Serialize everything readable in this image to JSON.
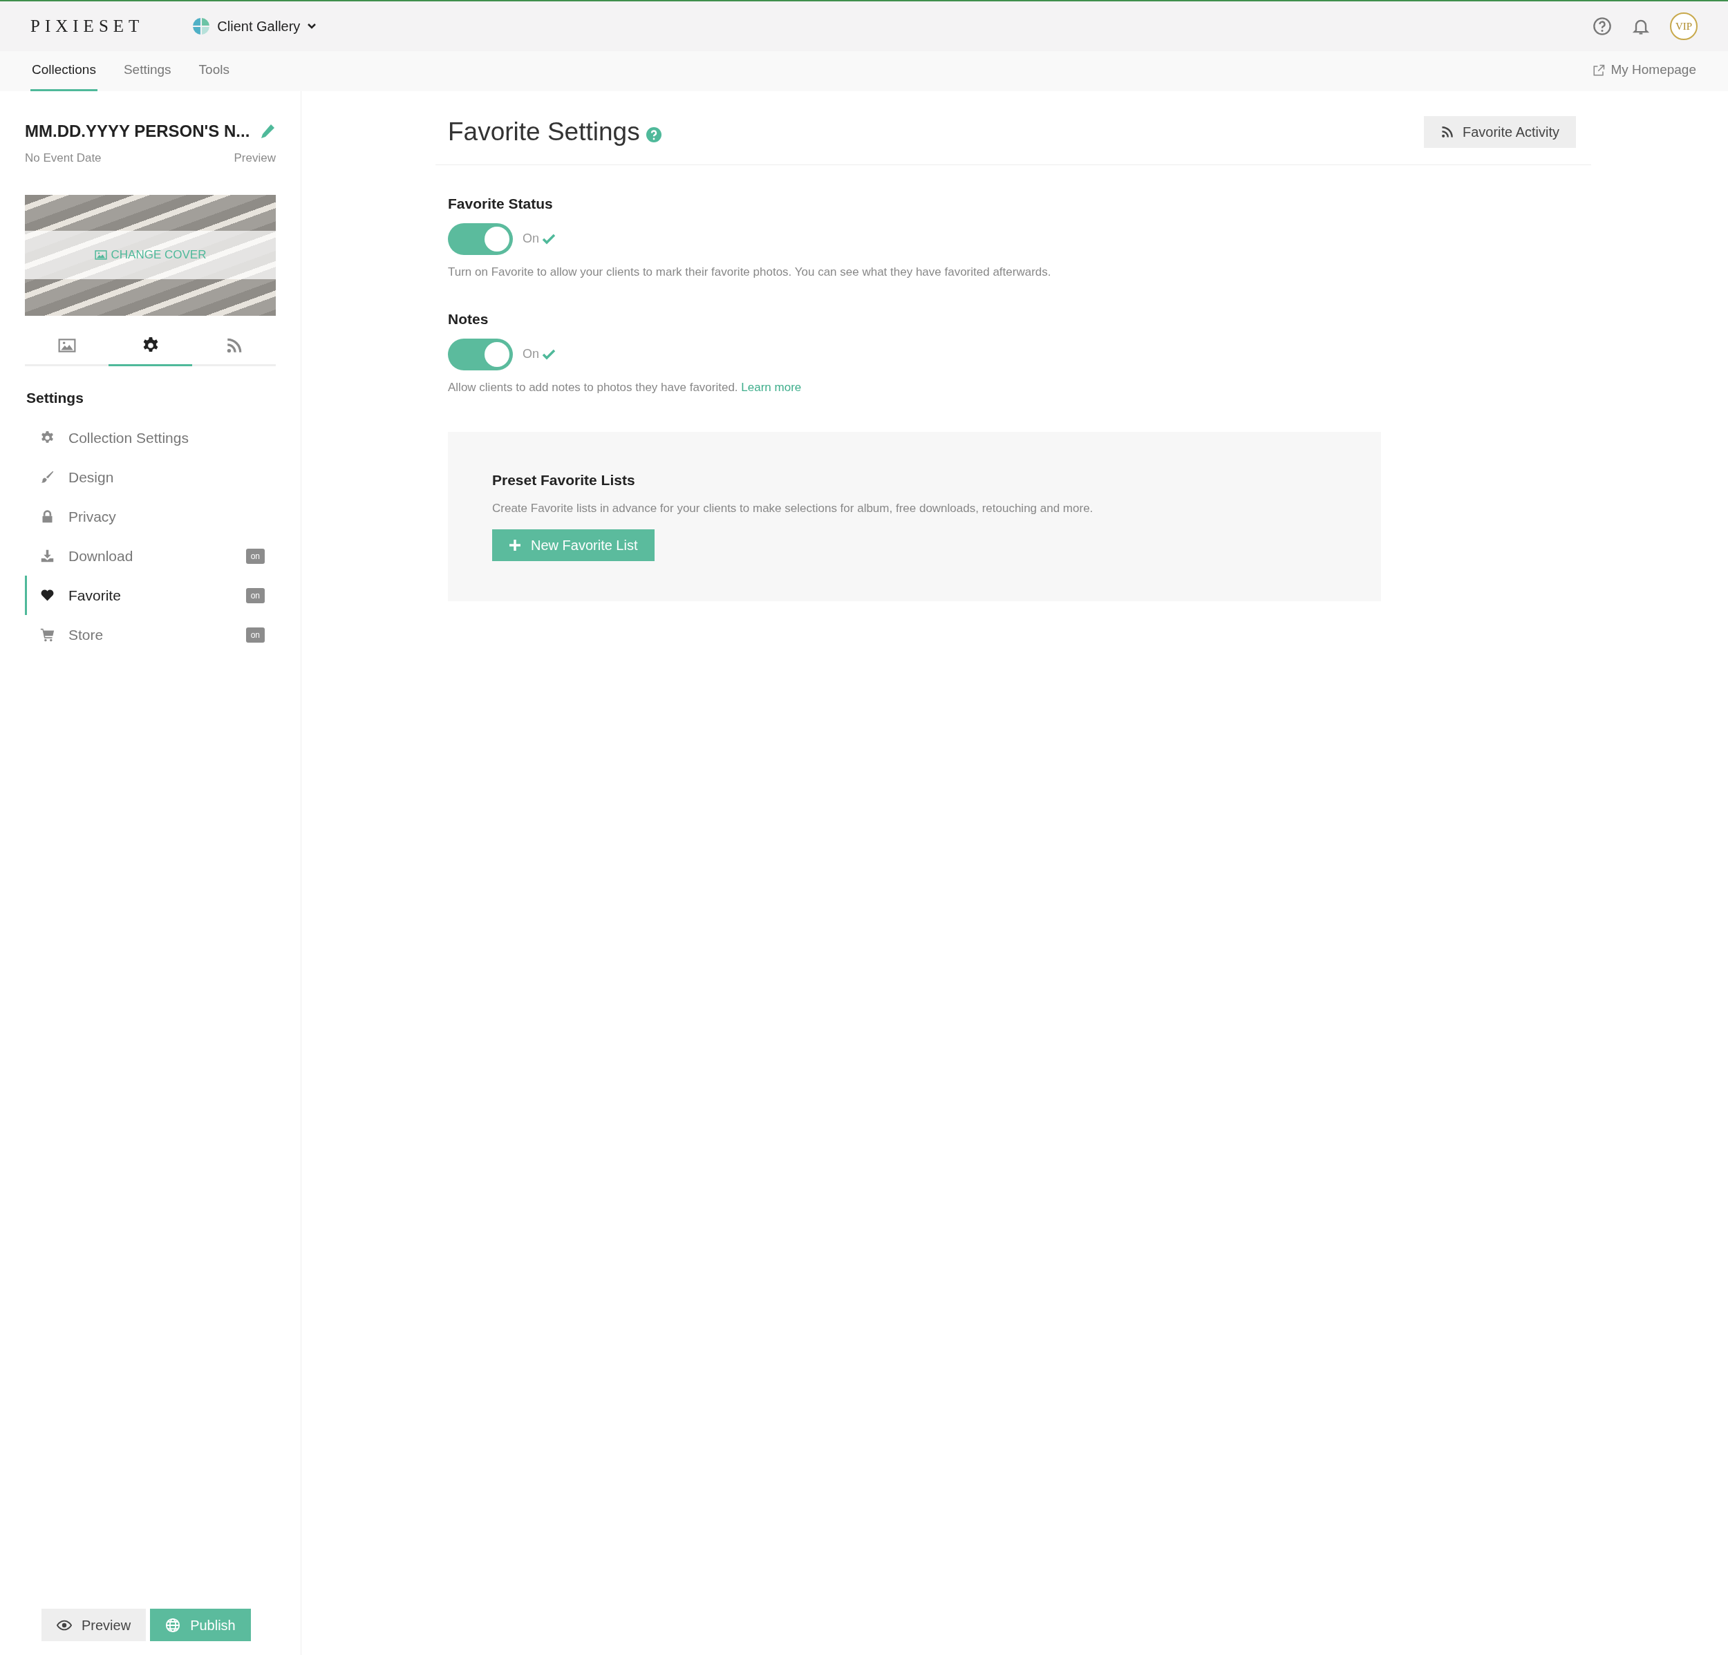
{
  "brand": "PIXIESET",
  "app_switcher": {
    "label": "Client Gallery"
  },
  "avatar": "VIP",
  "nav_tabs": [
    {
      "label": "Collections",
      "selected": true
    },
    {
      "label": "Settings",
      "selected": false
    },
    {
      "label": "Tools",
      "selected": false
    }
  ],
  "homepage_link": "My Homepage",
  "collection": {
    "title": "MM.DD.YYYY PERSON'S N...",
    "date": "No Event Date",
    "preview_link": "Preview",
    "cover_button": "CHANGE COVER"
  },
  "sidebar_tabs": [
    {
      "kind": "photos",
      "selected": false
    },
    {
      "kind": "settings",
      "selected": true
    },
    {
      "kind": "activity",
      "selected": false
    }
  ],
  "settings_heading": "Settings",
  "settings_items": [
    {
      "kind": "gear",
      "label": "Collection Settings",
      "selected": false
    },
    {
      "kind": "brush",
      "label": "Design",
      "selected": false
    },
    {
      "kind": "lock",
      "label": "Privacy",
      "selected": false
    },
    {
      "kind": "download",
      "label": "Download",
      "selected": false,
      "badge": "on"
    },
    {
      "kind": "heart",
      "label": "Favorite",
      "selected": true,
      "badge": "on"
    },
    {
      "kind": "cart",
      "label": "Store",
      "selected": false,
      "badge": "on"
    }
  ],
  "page": {
    "title": "Favorite Settings",
    "activity_button": "Favorite Activity"
  },
  "options": [
    {
      "title": "Favorite Status",
      "on": true,
      "state_label": "On",
      "description": "Turn on Favorite to allow your clients to mark their favorite photos. You can see what they have favorited afterwards."
    },
    {
      "title": "Notes",
      "on": true,
      "state_label": "On",
      "description": "Allow clients to add notes to photos they have favorited.",
      "link": "Learn more"
    }
  ],
  "preset": {
    "title": "Preset Favorite Lists",
    "description": "Create Favorite lists in advance for your clients to make selections for album, free downloads, retouching and more.",
    "button": "New Favorite List"
  },
  "footer_buttons": [
    {
      "kind": "preview",
      "label": "Preview"
    },
    {
      "kind": "publish",
      "label": "Publish"
    }
  ]
}
